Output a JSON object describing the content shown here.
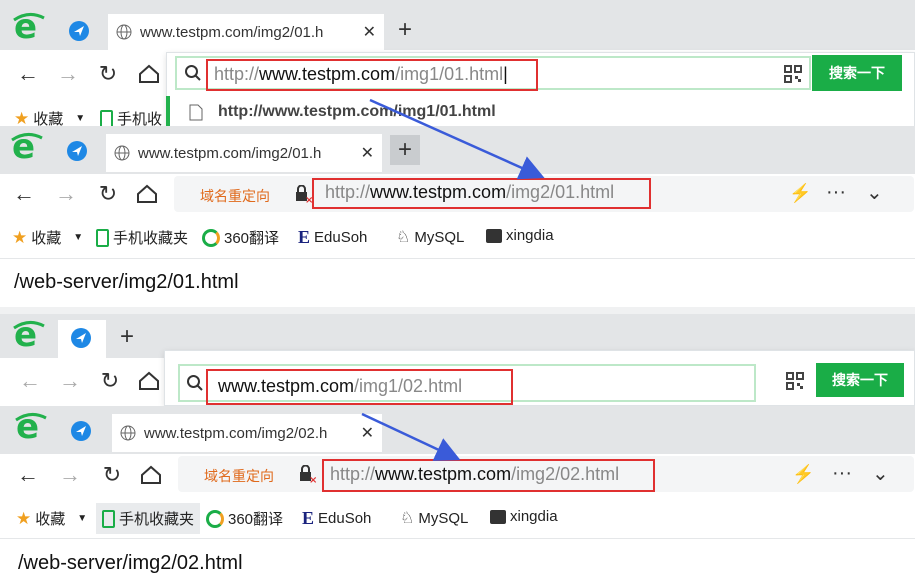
{
  "panel1": {
    "tab_title": "www.testpm.com/img2/01.h",
    "typed_url": {
      "scheme": "http://",
      "host": "www.testpm.com",
      "path": "/img1/01.html"
    },
    "suggestion": "http://www.testpm.com/img1/01.html",
    "search_button": "搜索一下",
    "bookmarks": [
      "收藏",
      "手机收"
    ]
  },
  "panel2": {
    "tab_title": "www.testpm.com/img2/01.h",
    "redirect_label": "域名重定向",
    "address_url": {
      "scheme": "http://",
      "host": "www.testpm.com",
      "path": "/img2/01.html"
    },
    "bookmarks": [
      "收藏",
      "手机收藏夹",
      "360翻译",
      "EduSoh",
      "MySQL",
      "xingdia"
    ],
    "page_text": "/web-server/img2/01.html"
  },
  "panel3": {
    "typed_url": {
      "host": "www.testpm.com",
      "path": "/img1/02.html"
    },
    "search_button": "搜索一下"
  },
  "panel4": {
    "tab_title": "www.testpm.com/img2/02.h",
    "redirect_label": "域名重定向",
    "address_url": {
      "scheme": "http://",
      "host": "www.testpm.com",
      "path": "/img2/02.html"
    },
    "bookmarks": [
      "收藏",
      "手机收藏夹",
      "360翻译",
      "EduSoh",
      "MySQL",
      "xingdia"
    ],
    "page_text": "/web-server/img2/02.html"
  },
  "colors": {
    "accent_green": "#1aad47",
    "highlight_red": "#e03030",
    "arrow_blue": "#3a5bd9",
    "redirect_orange": "#e06a1c"
  }
}
